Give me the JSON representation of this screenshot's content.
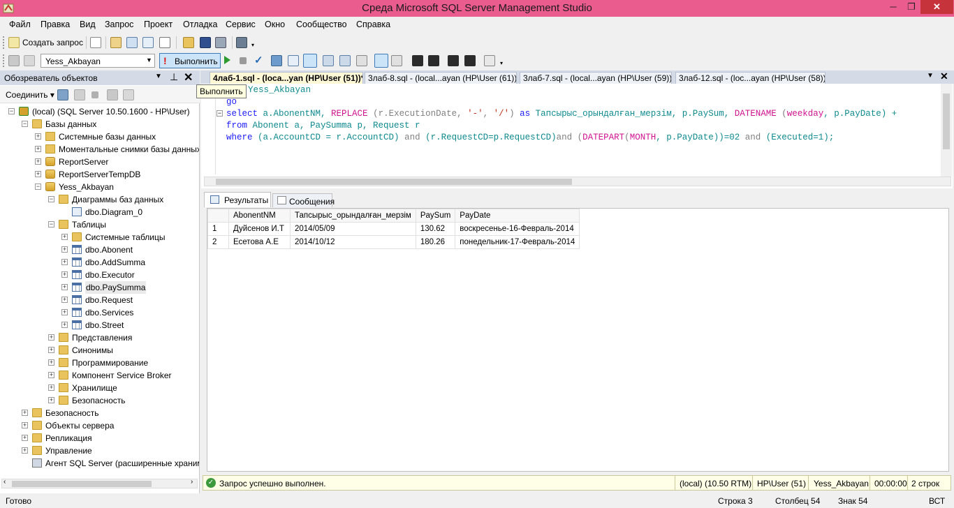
{
  "window": {
    "title": "Среда Microsoft SQL Server Management Studio",
    "min": "─",
    "max": "❐",
    "close": "✕"
  },
  "menu": [
    "Файл",
    "Правка",
    "Вид",
    "Запрос",
    "Проект",
    "Отладка",
    "Сервис",
    "Окно",
    "Сообщество",
    "Справка"
  ],
  "toolbar1": {
    "new_query": "Создать запрос"
  },
  "toolbar2": {
    "database": "Yess_Akbayan",
    "execute": "Выполнить"
  },
  "tooltip": "Выполнить",
  "object_explorer": {
    "title": "Обозреватель объектов",
    "connect": "Соединить",
    "tree": [
      {
        "label": "(local) (SQL Server 10.50.1600 - HP\\User)",
        "level": 0,
        "exp": "−",
        "icon": "server"
      },
      {
        "label": "Базы данных",
        "level": 1,
        "exp": "−",
        "icon": "folder"
      },
      {
        "label": "Системные базы данных",
        "level": 2,
        "exp": "+",
        "icon": "folder"
      },
      {
        "label": "Моментальные снимки базы данных",
        "level": 2,
        "exp": "+",
        "icon": "folder"
      },
      {
        "label": "ReportServer",
        "level": 2,
        "exp": "+",
        "icon": "db"
      },
      {
        "label": "ReportServerTempDB",
        "level": 2,
        "exp": "+",
        "icon": "db"
      },
      {
        "label": "Yess_Akbayan",
        "level": 2,
        "exp": "−",
        "icon": "db"
      },
      {
        "label": "Диаграммы баз данных",
        "level": 3,
        "exp": "−",
        "icon": "folder"
      },
      {
        "label": "dbo.Diagram_0",
        "level": 4,
        "exp": "",
        "icon": "diagram"
      },
      {
        "label": "Таблицы",
        "level": 3,
        "exp": "−",
        "icon": "folder"
      },
      {
        "label": "Системные таблицы",
        "level": 4,
        "exp": "+",
        "icon": "folder"
      },
      {
        "label": "dbo.Abonent",
        "level": 4,
        "exp": "+",
        "icon": "table"
      },
      {
        "label": "dbo.AddSumma",
        "level": 4,
        "exp": "+",
        "icon": "table"
      },
      {
        "label": "dbo.Executor",
        "level": 4,
        "exp": "+",
        "icon": "table"
      },
      {
        "label": "dbo.PaySumma",
        "level": 4,
        "exp": "+",
        "icon": "table"
      },
      {
        "label": "dbo.Request",
        "level": 4,
        "exp": "+",
        "icon": "table"
      },
      {
        "label": "dbo.Services",
        "level": 4,
        "exp": "+",
        "icon": "table"
      },
      {
        "label": "dbo.Street",
        "level": 4,
        "exp": "+",
        "icon": "table"
      },
      {
        "label": "Представления",
        "level": 3,
        "exp": "+",
        "icon": "folder"
      },
      {
        "label": "Синонимы",
        "level": 3,
        "exp": "+",
        "icon": "folder"
      },
      {
        "label": "Программирование",
        "level": 3,
        "exp": "+",
        "icon": "folder"
      },
      {
        "label": "Компонент Service Broker",
        "level": 3,
        "exp": "+",
        "icon": "folder"
      },
      {
        "label": "Хранилище",
        "level": 3,
        "exp": "+",
        "icon": "folder"
      },
      {
        "label": "Безопасность",
        "level": 3,
        "exp": "+",
        "icon": "folder"
      },
      {
        "label": "Безопасность",
        "level": 1,
        "exp": "+",
        "icon": "folder"
      },
      {
        "label": "Объекты сервера",
        "level": 1,
        "exp": "+",
        "icon": "folder"
      },
      {
        "label": "Репликация",
        "level": 1,
        "exp": "+",
        "icon": "folder"
      },
      {
        "label": "Управление",
        "level": 1,
        "exp": "+",
        "icon": "folder"
      },
      {
        "label": "Агент SQL Server (расширенные хранимые процедуры агента отключены)",
        "level": 1,
        "exp": "",
        "icon": "agent"
      }
    ]
  },
  "editor_tabs": [
    "4лаб-1.sql - (loca...yan (HP\\User (51))*",
    "3лаб-8.sql - (local...ayan (HP\\User (61))",
    "3лаб-7.sql - (local...ayan (HP\\User (59))",
    "3лаб-12.sql - (loc...ayan (HP\\User (58))"
  ],
  "code": {
    "line1": "Yess_Akbayan",
    "line2": "go",
    "line3_parts": [
      "select",
      " a.AbonentNM, ",
      "REPLACE",
      " (r.ExecutionDate, ",
      "'-'",
      ", ",
      "'/'",
      ") ",
      "as",
      " Тапсырыс_орындалған_мерзім, p.PaySum, ",
      "DATENAME",
      " (",
      "weekday",
      ", p.PayDate) +"
    ],
    "line4_parts": [
      "from",
      " Abonent a, PaySumma p, Request r"
    ],
    "line5_parts": [
      "where",
      " (a.AccountCD = r.AccountCD) ",
      "and",
      " (r.RequestCD=p.RequestCD)",
      "and",
      " (",
      "DATEPART",
      "(",
      "MONTH",
      ", p.PayDate))=02 ",
      "and",
      " (Executed=1);"
    ]
  },
  "results": {
    "tab_results": "Результаты",
    "tab_messages": "Сообщения",
    "columns": [
      "AbonentNM",
      "Тапсырыс_орындалған_мерзім",
      "PaySum",
      "PayDate"
    ],
    "rows": [
      {
        "n": "1",
        "cells": [
          "Дуйсенов И.Т",
          "2014/05/09",
          "130.62",
          "воскресенье-16-Февраль-2014"
        ]
      },
      {
        "n": "2",
        "cells": [
          "Есетова А.Е",
          "2014/10/12",
          "180.26",
          "понедельник-17-Февраль-2014"
        ]
      }
    ]
  },
  "query_status": {
    "message": "Запрос успешно выполнен.",
    "server": "(local) (10.50 RTM)",
    "user": "HP\\User (51)",
    "db": "Yess_Akbayan",
    "time": "00:00:00",
    "rows": "2 строк"
  },
  "statusbar": {
    "ready": "Готово",
    "line": "Строка 3",
    "col": "Столбец 54",
    "char": "Знак 54",
    "mode": "ВСТ"
  }
}
